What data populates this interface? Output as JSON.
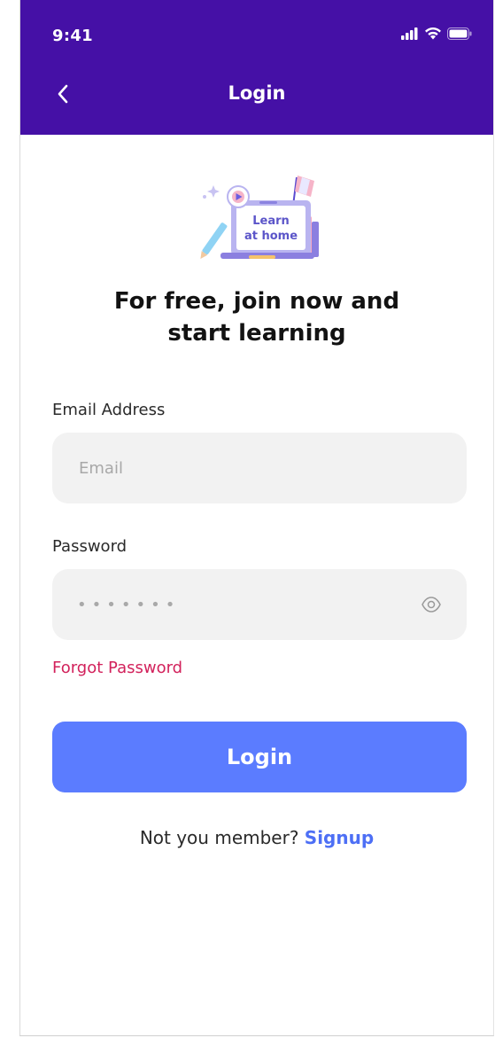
{
  "status_bar": {
    "time": "9:41"
  },
  "header": {
    "title": "Login"
  },
  "illustration": {
    "line1": "Learn",
    "line2": "at home"
  },
  "headline": {
    "line1": "For free, join now and",
    "line2": "start learning"
  },
  "form": {
    "email_label": "Email Address",
    "email_placeholder": "Email",
    "email_value": "",
    "password_label": "Password",
    "password_masked": "•••••••",
    "forgot_label": "Forgot Password",
    "login_label": "Login"
  },
  "footer": {
    "prompt": "Not you member?",
    "signup_label": "Signup"
  },
  "icons": {
    "back": "chevron-left-icon",
    "signal": "signal-icon",
    "wifi": "wifi-icon",
    "battery": "battery-icon",
    "eye": "eye-icon"
  },
  "colors": {
    "header_bg": "#4510a6",
    "primary_button": "#5b7cff",
    "forgot_link": "#d2215b",
    "signup_link": "#4d6ff5",
    "input_bg": "#f2f2f2"
  }
}
